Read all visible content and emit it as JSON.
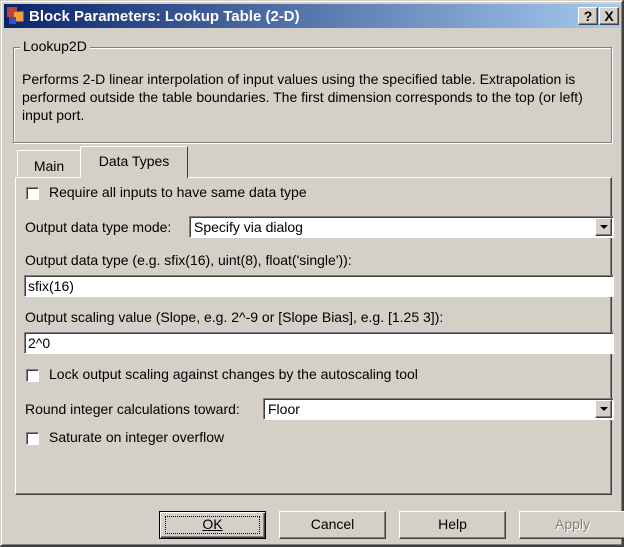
{
  "window": {
    "title": "Block Parameters: Lookup Table (2-D)",
    "help_button": "?",
    "close_button": "X",
    "icon": "simulink-block-icon"
  },
  "group": {
    "label": "Lookup2D",
    "description": "Performs 2-D linear interpolation of input values using the specified table.  Extrapolation is performed outside the table boundaries.  The first dimension corresponds to the top (or left) input port."
  },
  "tabs": [
    {
      "label": "Main",
      "selected": false
    },
    {
      "label": "Data Types",
      "selected": true
    }
  ],
  "data_types": {
    "require_same_type": {
      "label": "Require all inputs to have same data type",
      "checked": false
    },
    "output_mode": {
      "label": "Output data type mode:",
      "value": "Specify via dialog"
    },
    "output_type": {
      "label": "Output data type (e.g. sfix(16), uint(8), float('single')):",
      "value": "sfix(16)"
    },
    "output_scaling": {
      "label": "Output scaling value (Slope, e.g. 2^-9 or [Slope Bias], e.g. [1.25 3]):",
      "value": "2^0"
    },
    "lock_scaling": {
      "label": "Lock output scaling against changes by the autoscaling tool",
      "checked": false
    },
    "round_toward": {
      "label": "Round integer calculations toward:",
      "value": "Floor"
    },
    "saturate": {
      "label": "Saturate on integer overflow",
      "checked": false
    }
  },
  "buttons": {
    "ok": "OK",
    "cancel": "Cancel",
    "help": "Help",
    "apply": "Apply"
  },
  "colors": {
    "title_gradient_start": "#0a246a",
    "title_gradient_end": "#a6caf0",
    "face": "#d4d0c8"
  }
}
